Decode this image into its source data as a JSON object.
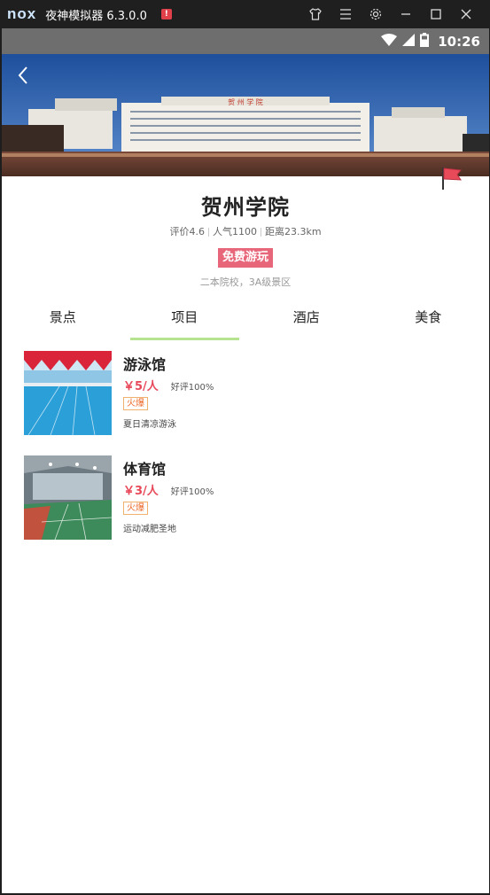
{
  "emulator": {
    "logo": "nox",
    "title": "夜神模拟器 6.3.0.0",
    "alert_icon": "alert-icon",
    "controls": [
      "tshirt-icon",
      "menu-icon",
      "gear-icon",
      "minimize-icon",
      "maximize-icon",
      "close-icon"
    ]
  },
  "statusbar": {
    "time": "10:26",
    "icons": [
      "wifi-icon",
      "signal-icon",
      "battery-icon"
    ]
  },
  "hero": {
    "banner_text": "贺 州 学 院"
  },
  "place": {
    "name": "贺州学院",
    "rating": "评价4.6",
    "popularity": "人气1100",
    "distance": "距离23.3km",
    "badge": "免费游玩",
    "description": "二本院校，3A级景区"
  },
  "tabs": [
    {
      "label": "景点",
      "active": false
    },
    {
      "label": "项目",
      "active": true
    },
    {
      "label": "酒店",
      "active": false
    },
    {
      "label": "美食",
      "active": false
    }
  ],
  "items": [
    {
      "title": "游泳馆",
      "price": "￥5/人",
      "rating": "好评100%",
      "tag": "火爆",
      "desc": "夏日清凉游泳"
    },
    {
      "title": "体育馆",
      "price": "￥3/人",
      "rating": "好评100%",
      "tag": "火爆",
      "desc": "运动减肥圣地"
    }
  ],
  "colors": {
    "accent_tab": "#b5e38f",
    "price": "#e8495a",
    "badge": "#e8667a",
    "tag_border": "#f2b26f"
  }
}
